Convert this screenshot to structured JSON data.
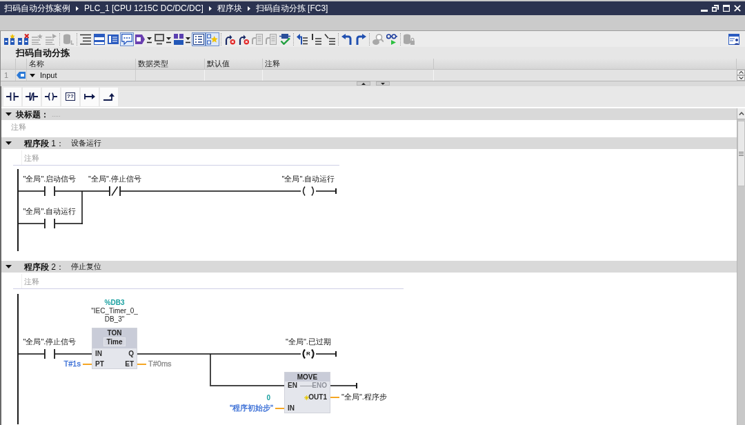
{
  "title_bar": {
    "breadcrumb": [
      "扫码自动分拣案例",
      "PLC_1 [CPU 1215C DC/DC/DC]",
      "程序块",
      "扫码自动分拣 [FC3]"
    ]
  },
  "toolbar": {
    "groups": [
      {
        "items": [
          {
            "kind": "network_star",
            "on": false,
            "disabled": false
          },
          {
            "kind": "network_cross",
            "on": false,
            "disabled": false
          },
          {
            "kind": "lines_star",
            "on": false,
            "disabled": true
          },
          {
            "kind": "lines_arrow",
            "on": false,
            "disabled": true
          }
        ]
      },
      {
        "items": [
          {
            "kind": "cylinder",
            "on": false,
            "disabled": true
          }
        ]
      },
      {
        "items": [
          {
            "kind": "lines",
            "on": false,
            "disabled": false
          },
          {
            "kind": "window",
            "on": false,
            "disabled": false
          },
          {
            "kind": "bars",
            "on": false,
            "disabled": false
          },
          {
            "kind": "speech_bubble",
            "on": true,
            "disabled": false
          },
          {
            "kind": "tag_dropdown",
            "on": false,
            "disabled": false
          },
          {
            "kind": "monitor_dropdown",
            "on": false,
            "disabled": false
          },
          {
            "kind": "network_dropdown",
            "on": false,
            "disabled": false
          },
          {
            "kind": "list",
            "on": true,
            "disabled": false
          },
          {
            "kind": "star_grid",
            "on": true,
            "disabled": false
          }
        ]
      },
      {
        "items": [
          {
            "kind": "arrow_cross",
            "on": false,
            "disabled": false
          },
          {
            "kind": "arrow_cross",
            "on": false,
            "disabled": false
          },
          {
            "kind": "page_arrow",
            "on": false,
            "disabled": true
          },
          {
            "kind": "page_arrow",
            "on": false,
            "disabled": true
          },
          {
            "kind": "chip_check",
            "on": false,
            "disabled": false
          }
        ]
      },
      {
        "items": [
          {
            "kind": "arrow_lines",
            "on": false,
            "disabled": false
          },
          {
            "kind": "bar_lines",
            "on": false,
            "disabled": false
          },
          {
            "kind": "tree_lines",
            "on": false,
            "disabled": false
          }
        ]
      },
      {
        "items": [
          {
            "kind": "curved_arrow_left",
            "on": false,
            "disabled": false
          },
          {
            "kind": "curved_arrow_right",
            "on": false,
            "disabled": false
          }
        ]
      },
      {
        "items": [
          {
            "kind": "search",
            "on": false,
            "disabled": true
          },
          {
            "kind": "glasses_play",
            "on": false,
            "disabled": false
          }
        ]
      },
      {
        "items": [
          {
            "kind": "cylinder_lock",
            "on": false,
            "disabled": true
          }
        ]
      }
    ],
    "end": [
      {
        "kind": "window_person",
        "on": false,
        "disabled": false
      }
    ]
  },
  "block_interface": {
    "title": "扫码自动分拣",
    "columns": [
      "名称",
      "数据类型",
      "默认值",
      "注释"
    ],
    "rows": [
      {
        "number": "1",
        "name": "Input",
        "expanded": true
      }
    ]
  },
  "ladder_palette": [
    {
      "kind": "no_contact"
    },
    {
      "kind": "nc_contact"
    },
    {
      "kind": "coil"
    },
    {
      "kind": "empty_box",
      "label": "??"
    },
    {
      "kind": "open_branch"
    },
    {
      "kind": "close_branch"
    }
  ],
  "block_title": {
    "label": "块标题：",
    "title": {
      "placeholder": "....."
    },
    "expanded": true,
    "comment": {
      "placeholder": "注释"
    }
  },
  "networks": [
    {
      "label": "**程序段** 1：",
      "title": "设备运行",
      "expanded": true,
      "comment": {
        "placeholder": "注释"
      },
      "elements": [
        {
          "kind": "no_contact",
          "operand": "\"全局\".启动信号"
        },
        {
          "kind": "no_contact",
          "operand": "\"全局\".自动运行"
        },
        {
          "kind": "nc_contact",
          "operand": "\"全局\".停止信号"
        },
        {
          "kind": "coil",
          "operand": "\"全局\".自动运行"
        }
      ]
    },
    {
      "label": "**程序段** 2：",
      "title": "停止复位",
      "expanded": true,
      "comment": {
        "placeholder": "注释"
      },
      "elements": [
        {
          "kind": "no_contact",
          "operand": "\"全局\".停止信号"
        },
        {
          "kind": "timer_box",
          "instance": "%DB3",
          "instance_name_lines": [
            "\"IEC_Timer_0_",
            "DB_3\""
          ],
          "type": "TON",
          "subtype": "Time",
          "inputs": [
            {
              "pin": "IN"
            },
            {
              "pin": "PT",
              "operand": "T#1s",
              "color": "#3b6fd6"
            }
          ],
          "outputs": [
            {
              "pin": "Q"
            },
            {
              "pin": "ET",
              "operand": "T#0ms",
              "color": "#8e8e8e"
            }
          ]
        },
        {
          "kind": "reset_coil",
          "operand": "\"全局\".已过期",
          "symbol": "R"
        },
        {
          "kind": "move_box",
          "type": "MOVE",
          "inputs": [
            {
              "pin": "EN"
            },
            {
              "pin": "IN",
              "value": "0",
              "operand": "\"程序初始步\"",
              "color": "#3b6fd6"
            }
          ],
          "outputs": [
            {
              "pin": "ENO",
              "disabled": true
            },
            {
              "pin": "OUT1",
              "operand": "\"全局\".程序步",
              "disabled": false
            }
          ]
        }
      ]
    }
  ]
}
